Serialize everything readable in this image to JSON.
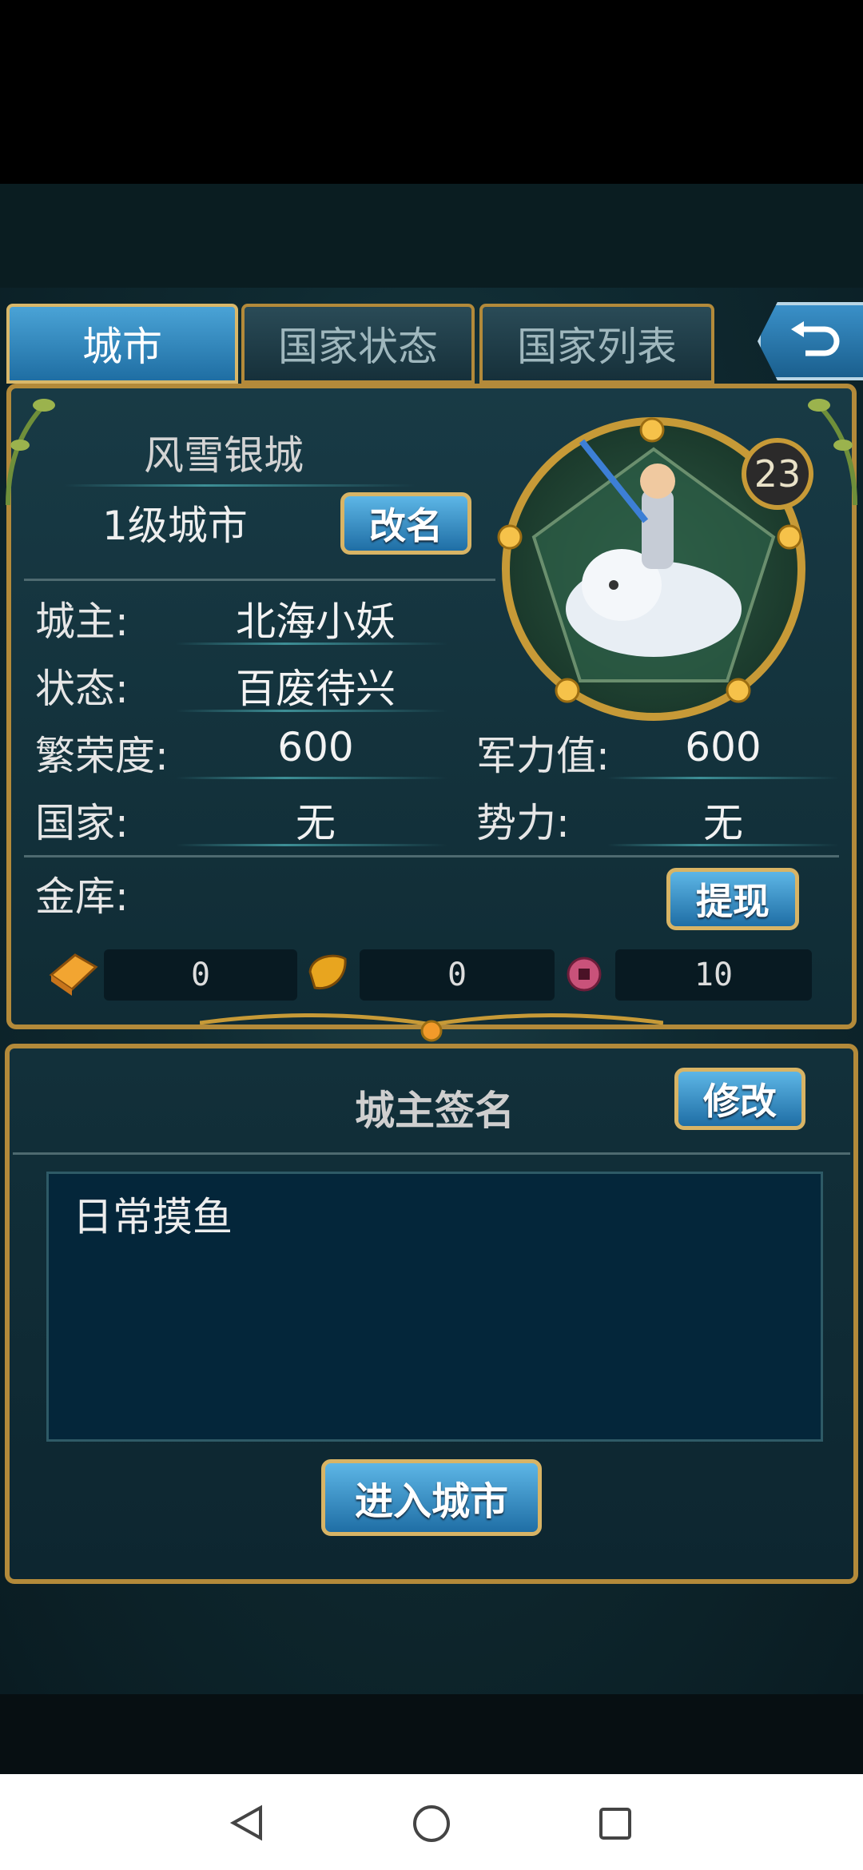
{
  "tabs": [
    {
      "label": "城市",
      "active": true
    },
    {
      "label": "国家状态",
      "active": false
    },
    {
      "label": "国家列表",
      "active": false
    }
  ],
  "city": {
    "name": "风雪银城",
    "level_text": "1级城市",
    "rename_label": "改名",
    "avatar_level": "23"
  },
  "info": {
    "owner_label": "城主:",
    "owner_value": "北海小妖",
    "status_label": "状态:",
    "status_value": "百废待兴",
    "prosperity_label": "繁荣度:",
    "prosperity_value": "600",
    "military_label": "军力值:",
    "military_value": "600",
    "country_label": "国家:",
    "country_value": "无",
    "faction_label": "势力:",
    "faction_value": "无",
    "treasury_label": "金库:",
    "withdraw_label": "提现"
  },
  "resources": {
    "gold": "0",
    "leaf": "0",
    "coin": "10"
  },
  "signature": {
    "title": "城主签名",
    "edit_label": "修改",
    "text": "日常摸鱼"
  },
  "enter_city_label": "进入城市",
  "colors": {
    "gold_border": "#b38a3a",
    "active_tab": "#1f6ea3",
    "button": "#1f6ea5"
  }
}
